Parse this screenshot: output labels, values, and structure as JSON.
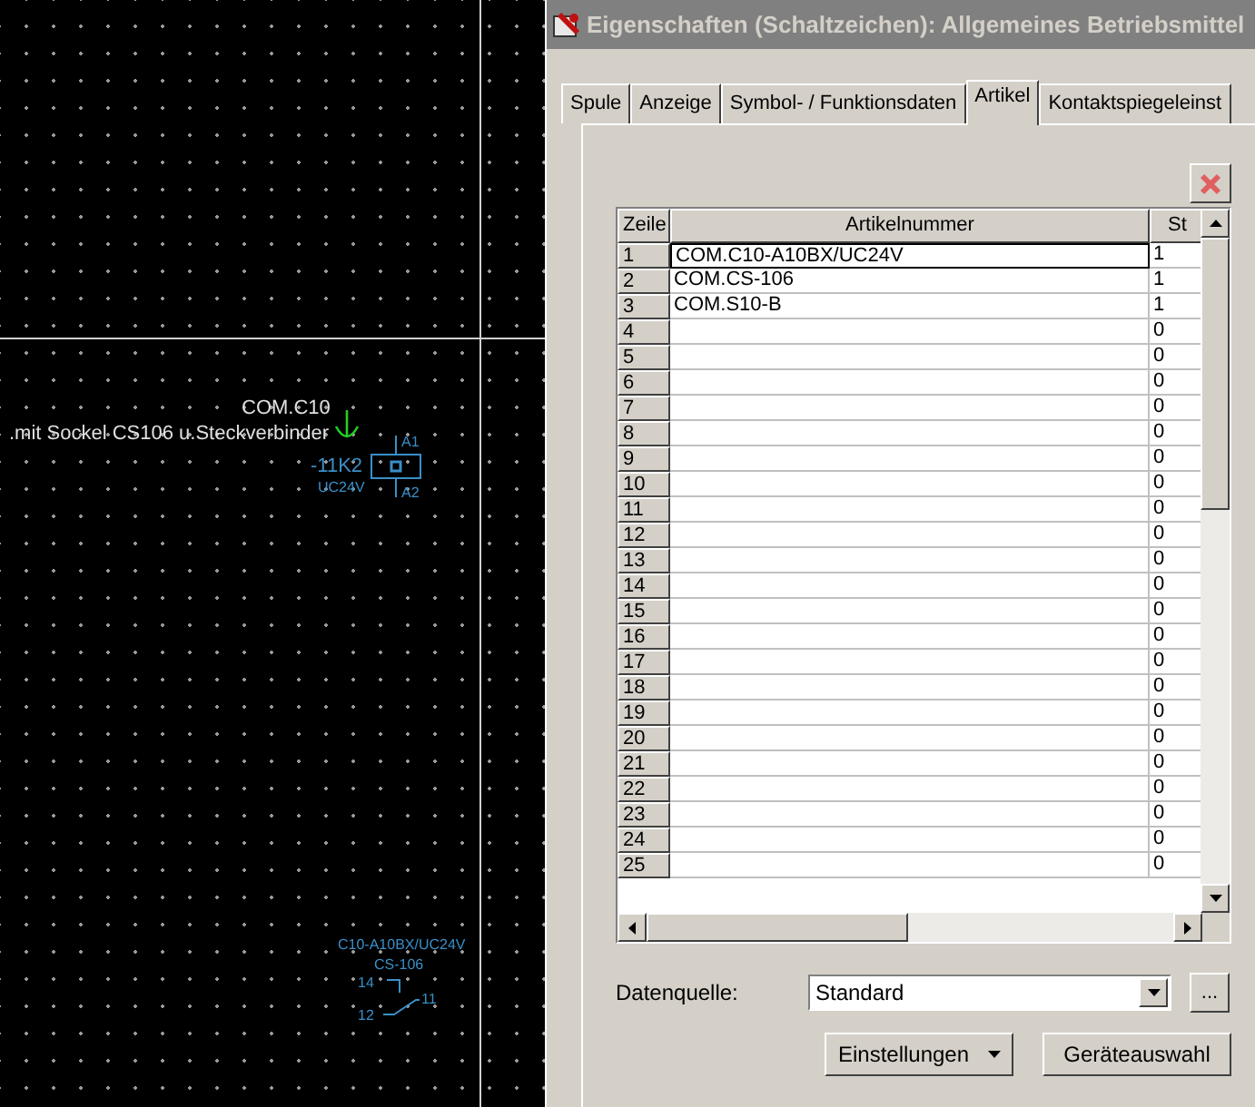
{
  "canvas": {
    "texts": [
      {
        "kind": "comment",
        "text": "COM.C10"
      },
      {
        "kind": "comment",
        "text": ".mit Sockel CS106 u.Steckverbinder"
      },
      {
        "kind": "tag",
        "text": "-11K2"
      },
      {
        "kind": "small",
        "text": "UC24V"
      },
      {
        "kind": "small",
        "text": "A1"
      },
      {
        "kind": "small",
        "text": "A2"
      },
      {
        "kind": "small",
        "text": "C10-A10BX/UC24V"
      },
      {
        "kind": "small",
        "text": "CS-106"
      },
      {
        "kind": "small",
        "text": "14"
      },
      {
        "kind": "small",
        "text": "11"
      },
      {
        "kind": "small",
        "text": "12"
      }
    ]
  },
  "dialog": {
    "title": "Eigenschaften (Schaltzeichen): Allgemeines Betriebsmittel",
    "tabs": [
      {
        "label": "Spule",
        "selected": false
      },
      {
        "label": "Anzeige",
        "selected": false
      },
      {
        "label": "Symbol- / Funktionsdaten",
        "selected": false
      },
      {
        "label": "Artikel",
        "selected": true
      },
      {
        "label": "Kontaktspiegeleinst",
        "selected": false
      }
    ],
    "table": {
      "columns": [
        "Zeile",
        "Artikelnummer",
        "St"
      ],
      "rows": [
        {
          "cells": [
            "1",
            "COM.C10-A10BX/UC24V",
            "1"
          ],
          "selected": true
        },
        {
          "cells": [
            "2",
            "COM.CS-106",
            "1"
          ],
          "selected": false
        },
        {
          "cells": [
            "3",
            "COM.S10-B",
            "1"
          ],
          "selected": false
        },
        {
          "cells": [
            "4",
            "",
            "0"
          ],
          "selected": false
        },
        {
          "cells": [
            "5",
            "",
            "0"
          ],
          "selected": false
        },
        {
          "cells": [
            "6",
            "",
            "0"
          ],
          "selected": false
        },
        {
          "cells": [
            "7",
            "",
            "0"
          ],
          "selected": false
        },
        {
          "cells": [
            "8",
            "",
            "0"
          ],
          "selected": false
        },
        {
          "cells": [
            "9",
            "",
            "0"
          ],
          "selected": false
        },
        {
          "cells": [
            "10",
            "",
            "0"
          ],
          "selected": false
        },
        {
          "cells": [
            "11",
            "",
            "0"
          ],
          "selected": false
        },
        {
          "cells": [
            "12",
            "",
            "0"
          ],
          "selected": false
        },
        {
          "cells": [
            "13",
            "",
            "0"
          ],
          "selected": false
        },
        {
          "cells": [
            "14",
            "",
            "0"
          ],
          "selected": false
        },
        {
          "cells": [
            "15",
            "",
            "0"
          ],
          "selected": false
        },
        {
          "cells": [
            "16",
            "",
            "0"
          ],
          "selected": false
        },
        {
          "cells": [
            "17",
            "",
            "0"
          ],
          "selected": false
        },
        {
          "cells": [
            "18",
            "",
            "0"
          ],
          "selected": false
        },
        {
          "cells": [
            "19",
            "",
            "0"
          ],
          "selected": false
        },
        {
          "cells": [
            "20",
            "",
            "0"
          ],
          "selected": false
        },
        {
          "cells": [
            "21",
            "",
            "0"
          ],
          "selected": false
        },
        {
          "cells": [
            "22",
            "",
            "0"
          ],
          "selected": false
        },
        {
          "cells": [
            "23",
            "",
            "0"
          ],
          "selected": false
        },
        {
          "cells": [
            "24",
            "",
            "0"
          ],
          "selected": false
        },
        {
          "cells": [
            "25",
            "",
            "0"
          ],
          "selected": false
        }
      ]
    },
    "datasource": {
      "label": "Datenquelle:",
      "value": "Standard",
      "browse": "..."
    },
    "buttons": [
      {
        "kind": "menu",
        "label": "Einstellungen"
      },
      {
        "kind": "plain",
        "label": "Geräteauswahl"
      }
    ]
  }
}
